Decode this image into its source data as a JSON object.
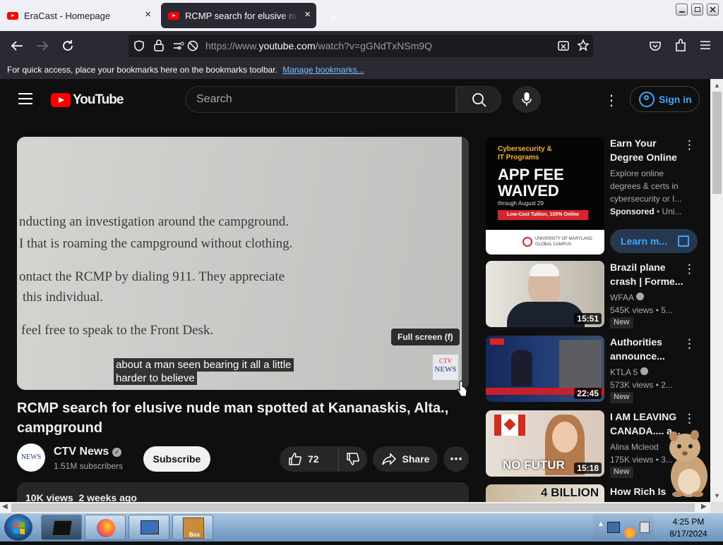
{
  "browser": {
    "tabs": [
      {
        "title": "EraCast - Homepage",
        "active": false
      },
      {
        "title": "RCMP search for elusive nude man spotted at Kananaskis, Alta., campground",
        "active": true
      }
    ],
    "new_tab": "+",
    "url_prefix": "https://www.",
    "url_host": "youtube.com",
    "url_path": "/watch?v=gGNdTxNSm9Q",
    "bookmarks_hint": "For quick access, place your bookmarks here on the bookmarks toolbar.",
    "bookmarks_link": "Manage bookmarks...",
    "close_glyph": "×"
  },
  "youtube": {
    "logo_text": "YouTube",
    "search_placeholder": "Search",
    "sign_in": "Sign in"
  },
  "player": {
    "paper_lines": [
      "nducting an investigation around the campground.",
      "I that is roaming the campground without clothing.",
      "ontact the RCMP by dialing 911. They appreciate",
      "this individual.",
      "feel free to speak to the Front Desk."
    ],
    "caption_lines": [
      "about a man seen bearing it all a little",
      "harder to believe"
    ],
    "fullscreen_tip": "Full screen (f)",
    "news_bug_top": "CTV",
    "news_bug_bottom": "NEWS"
  },
  "video": {
    "title": "RCMP search for elusive nude man spotted at Kananaskis, Alta., campground",
    "channel": "CTV News",
    "subscribers": "1.51M subscribers",
    "subscribe_label": "Subscribe",
    "likes": "72",
    "share_label": "Share",
    "views_date": "10K views  2 weeks ago",
    "avatar_text": "NEWS"
  },
  "sidebar": [
    {
      "type": "ad",
      "thumb_lines": [
        "Cybersecurity &",
        "IT Programs",
        "APP FEE",
        "WAIVED",
        "through August 29",
        "Low-Cost Tuition, 100% Online",
        "UNIVERSITY OF MARYLAND GLOBAL CAMPUS"
      ],
      "title": "Earn Your Degree Online",
      "desc": "Explore online degrees & certs in cybersecurity or I...",
      "sponsored": "Sponsored",
      "advertiser": " • Uni...",
      "cta": "Learn m..."
    },
    {
      "title": "Brazil plane crash | Forme...",
      "channel": "WFAA",
      "meta": "545K views  • 5...",
      "duration": "15:51",
      "badge": "New"
    },
    {
      "title": "Authorities announce...",
      "channel": "KTLA 5",
      "meta": "573K views  • 2...",
      "duration": "22:45",
      "badge": "New"
    },
    {
      "title": "I AM LEAVING CANADA.... a...",
      "channel": "Alina Mcleod",
      "meta": "175K views  • 3...",
      "duration": "15:18",
      "badge": "New",
      "thumb_text": "NO FUTUR"
    },
    {
      "title": "How Rich Is",
      "thumb_text": "4 BILLION"
    }
  ],
  "taskbar": {
    "time": "4:25 PM",
    "date": "8/17/2024",
    "box_label": "Box"
  },
  "colors": {
    "yt_bg": "#0f0f0f",
    "yt_red": "#ff0000",
    "link_blue": "#3ea6ff",
    "chrome_dark": "#2b2a33"
  }
}
